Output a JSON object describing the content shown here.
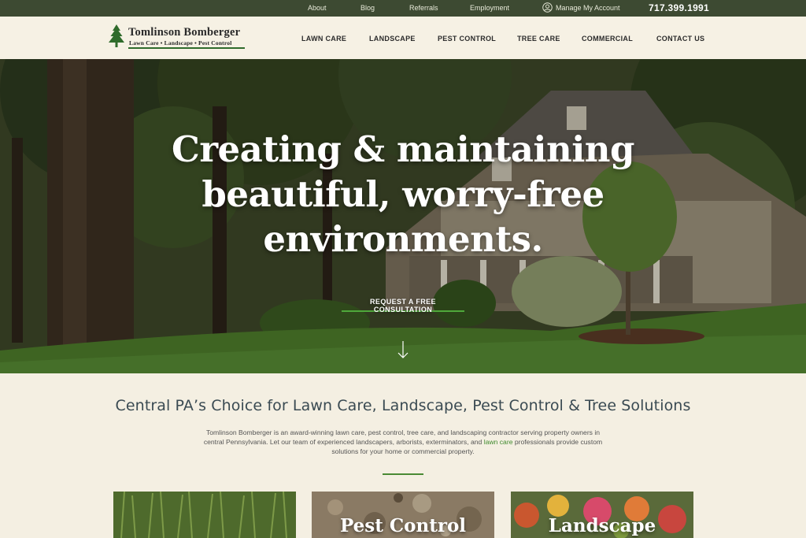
{
  "topbar": {
    "links": [
      "About",
      "Blog",
      "Referrals",
      "Employment"
    ],
    "account_label": "Manage My Account",
    "phone": "717.399.1991"
  },
  "logo": {
    "name": "Tomlinson Bomberger",
    "tagline": "Lawn Care • Landscape • Pest Control"
  },
  "nav": [
    "LAWN CARE",
    "LANDSCAPE",
    "PEST CONTROL",
    "TREE CARE",
    "COMMERCIAL",
    "CONTACT US"
  ],
  "hero": {
    "headline_lines": [
      "Creating & maintaining",
      "beautiful, worry-free",
      "environments."
    ],
    "cta": "REQUEST A FREE CONSULTATION"
  },
  "intro": {
    "title": "Central PA’s Choice for Lawn Care, Landscape, Pest Control & Tree Solutions",
    "body_before": "Tomlinson Bomberger is an award-winning lawn care, pest control, tree care, and landscaping contractor serving property owners in central Pennsylvania. Let our team of experienced landscapers, arborists, exterminators, and ",
    "body_link": "lawn care",
    "body_after": " professionals provide custom solutions for your home or commercial property."
  },
  "cards": [
    {
      "label": ""
    },
    {
      "label": "Pest Control"
    },
    {
      "label": "Landscape"
    }
  ],
  "colors": {
    "topbar": "#3d4a32",
    "accent_green": "#4fa83b",
    "link_green": "#3f8a2d",
    "background": "#f4efe2"
  },
  "icons": {
    "account": "user-circle-icon",
    "scroll": "arrow-down-icon",
    "logo": "pine-tree-icon"
  }
}
